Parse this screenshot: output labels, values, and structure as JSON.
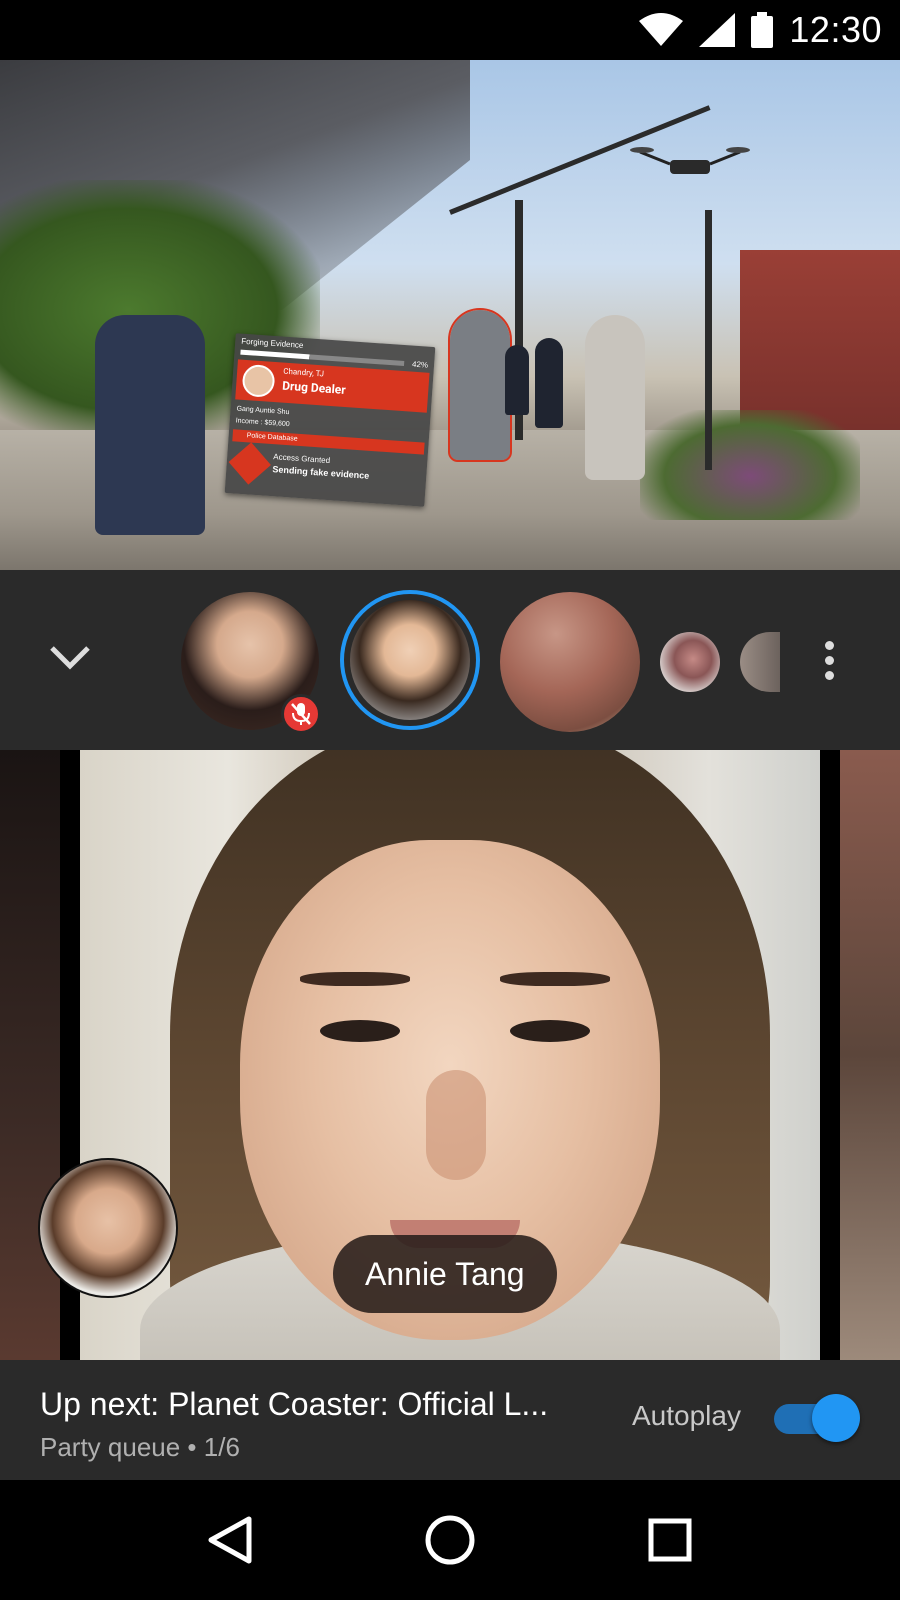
{
  "status_bar": {
    "time": "12:30",
    "icons": [
      "wifi-icon",
      "cellular-signal-icon",
      "battery-icon"
    ]
  },
  "game_video": {
    "hud": {
      "header": "Forging Evidence",
      "progress_percent": 42,
      "progress_label": "42%",
      "target_name": "Chandry, TJ",
      "target_role": "Drug Dealer",
      "gang": "Gang Auntie Shu",
      "income": "Income : $59,600",
      "database": "Police Database",
      "access": "Access Granted",
      "status": "Sending fake evidence"
    }
  },
  "participants": {
    "collapse_icon": "chevron-down-icon",
    "more_icon": "more-vert-icon",
    "muted_icon": "mic-off-icon",
    "active_ring_color": "#2196f3",
    "mute_badge_color": "#e53935"
  },
  "stage": {
    "speaker_name": "Annie Tang"
  },
  "up_next": {
    "title": "Up next: Planet Coaster: Official L...",
    "subtitle": "Party queue • 1/6",
    "autoplay_label": "Autoplay",
    "autoplay_on": true,
    "toggle_color": "#2196f3"
  },
  "nav_bar": {
    "icons": [
      "back-icon",
      "home-icon",
      "recents-icon"
    ]
  }
}
